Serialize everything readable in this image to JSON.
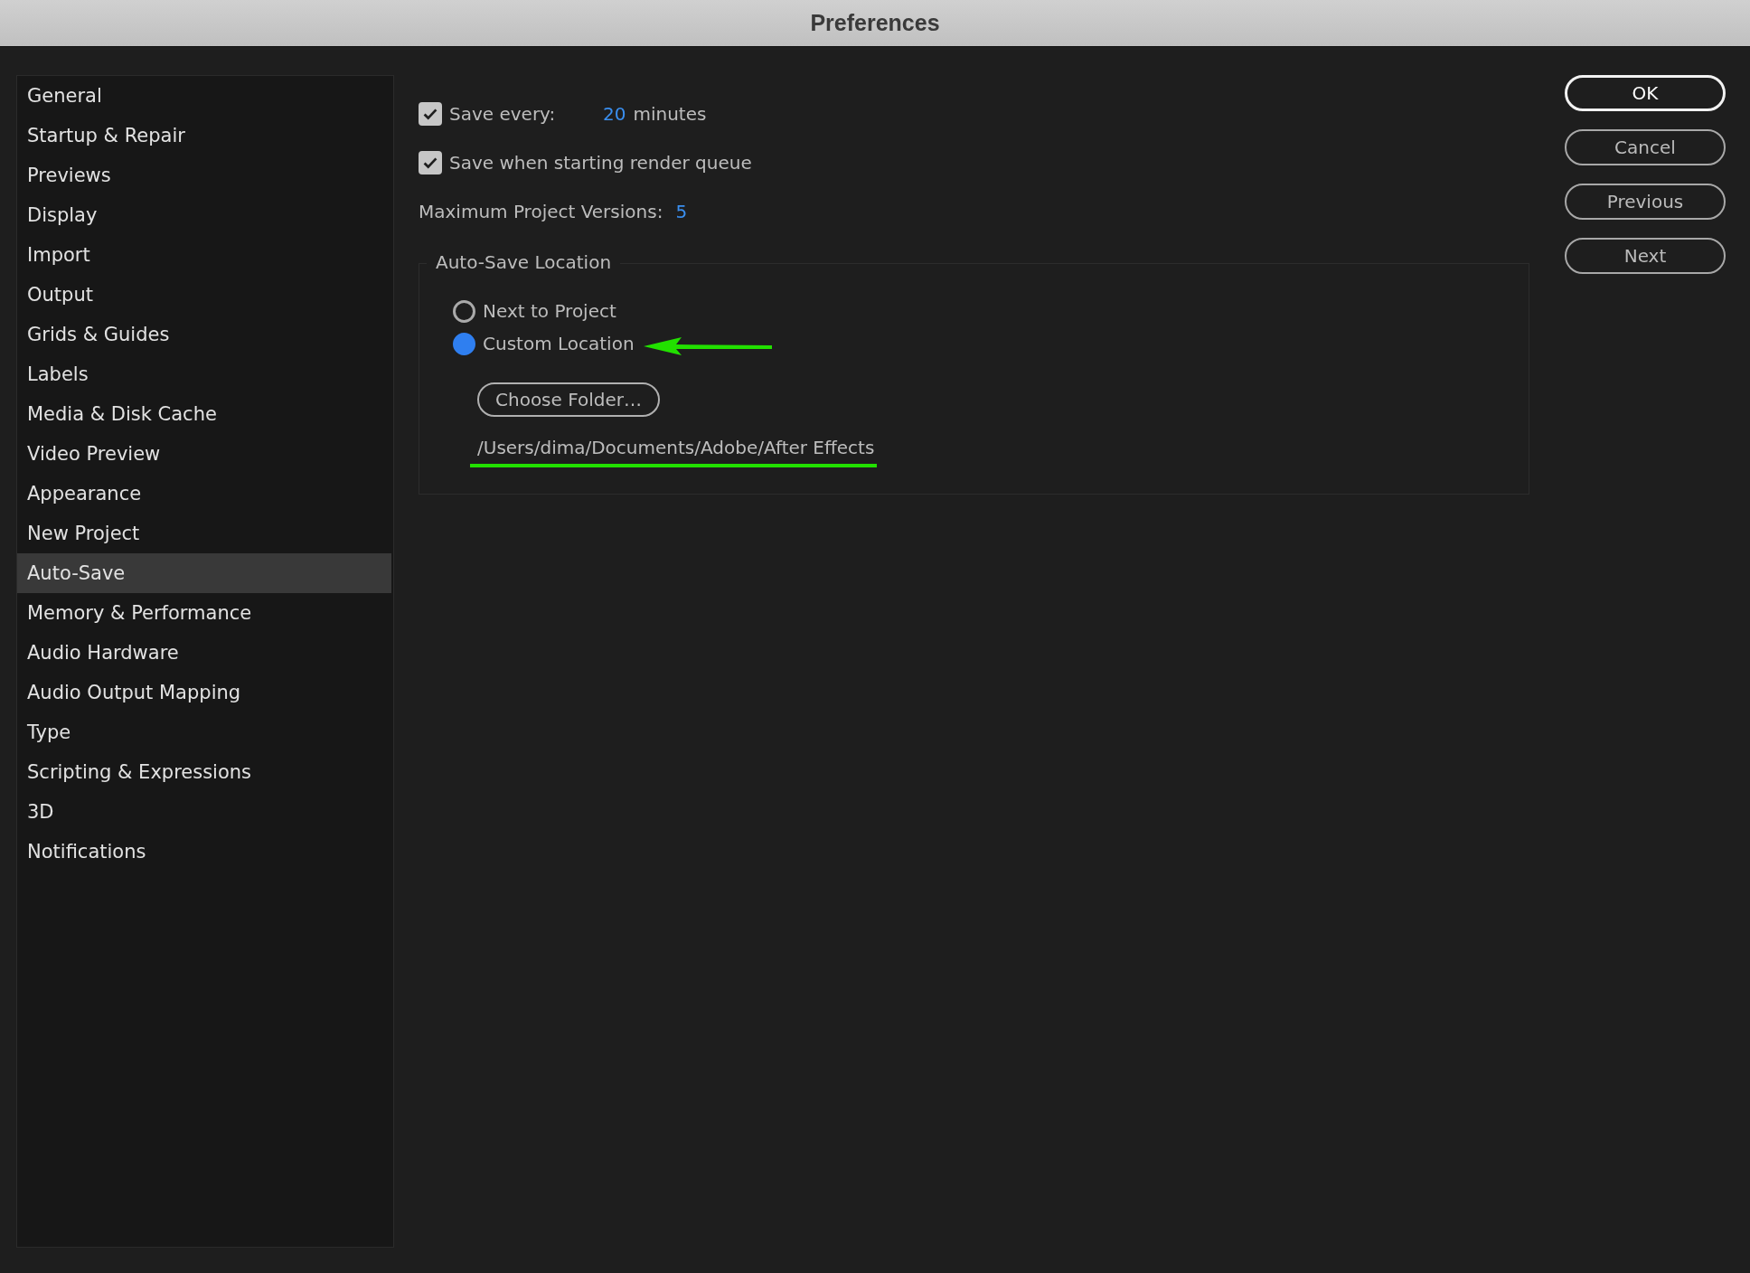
{
  "window": {
    "title": "Preferences"
  },
  "sidebar": {
    "items": [
      {
        "label": "General",
        "selected": false
      },
      {
        "label": "Startup & Repair",
        "selected": false
      },
      {
        "label": "Previews",
        "selected": false
      },
      {
        "label": "Display",
        "selected": false
      },
      {
        "label": "Import",
        "selected": false
      },
      {
        "label": "Output",
        "selected": false
      },
      {
        "label": "Grids & Guides",
        "selected": false
      },
      {
        "label": "Labels",
        "selected": false
      },
      {
        "label": "Media & Disk Cache",
        "selected": false
      },
      {
        "label": "Video Preview",
        "selected": false
      },
      {
        "label": "Appearance",
        "selected": false
      },
      {
        "label": "New Project",
        "selected": false
      },
      {
        "label": "Auto-Save",
        "selected": true
      },
      {
        "label": "Memory & Performance",
        "selected": false
      },
      {
        "label": "Audio Hardware",
        "selected": false
      },
      {
        "label": "Audio Output Mapping",
        "selected": false
      },
      {
        "label": "Type",
        "selected": false
      },
      {
        "label": "Scripting & Expressions",
        "selected": false
      },
      {
        "label": "3D",
        "selected": false
      },
      {
        "label": "Notifications",
        "selected": false
      }
    ]
  },
  "autosave": {
    "save_every": {
      "label": "Save every:",
      "checked": true,
      "value": "20",
      "unit": "minutes"
    },
    "save_on_render": {
      "label": "Save when starting render queue",
      "checked": true
    },
    "max_versions": {
      "label": "Maximum Project Versions:",
      "value": "5"
    },
    "location": {
      "legend": "Auto-Save Location",
      "options": [
        {
          "label": "Next to Project",
          "selected": false
        },
        {
          "label": "Custom Location",
          "selected": true
        }
      ],
      "choose_button": "Choose Folder…",
      "path": "/Users/dima/Documents/Adobe/After Effects"
    }
  },
  "buttons": [
    {
      "label": "OK",
      "kind": "default"
    },
    {
      "label": "Cancel",
      "kind": "normal"
    },
    {
      "label": "Previous",
      "kind": "normal"
    },
    {
      "label": "Next",
      "kind": "normal"
    }
  ]
}
